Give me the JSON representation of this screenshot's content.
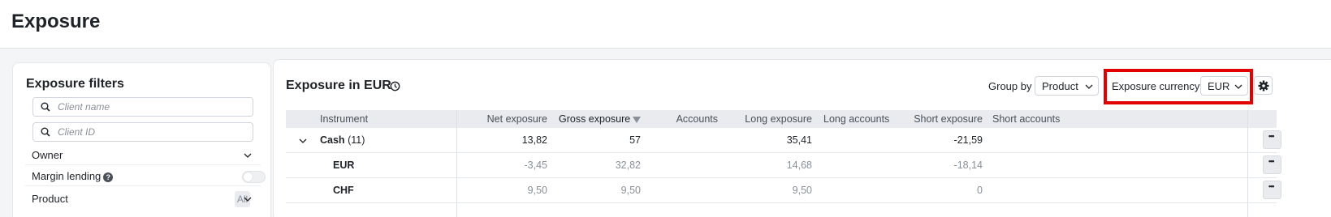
{
  "page": {
    "title": "Exposure"
  },
  "filters": {
    "title": "Exposure filters",
    "client_name_placeholder": "Client name",
    "client_id_placeholder": "Client ID",
    "owner_label": "Owner",
    "margin_lending_label": "Margin lending",
    "margin_lending_enabled": false,
    "product_label": "Product",
    "product_value": "All"
  },
  "main": {
    "title": "Exposure in EUR",
    "group_by_label": "Group by",
    "group_by_value": "Product",
    "currency_label": "Exposure currency",
    "currency_value": "EUR"
  },
  "table": {
    "columns": {
      "instrument": "Instrument",
      "net": "Net exposure",
      "gross": "Gross exposure",
      "accounts": "Accounts",
      "long": "Long exposure",
      "long_accounts": "Long accounts",
      "short": "Short exposure",
      "short_accounts": "Short accounts"
    },
    "sorted_column": "gross",
    "sort_direction": "desc",
    "rows": [
      {
        "name": "Cash",
        "count": "(11)",
        "net": "13,82",
        "gross": "57",
        "accounts": "",
        "long": "35,41",
        "long_accounts": "",
        "short": "-21,59",
        "short_accounts": "",
        "expanded": true
      },
      {
        "name": "EUR",
        "net": "-3,45",
        "gross": "32,82",
        "accounts": "",
        "long": "14,68",
        "long_accounts": "",
        "short": "-18,14",
        "short_accounts": ""
      },
      {
        "name": "CHF",
        "net": "9,50",
        "gross": "9,50",
        "accounts": "",
        "long": "9,50",
        "long_accounts": "",
        "short": "0",
        "short_accounts": ""
      }
    ]
  },
  "colors": {
    "highlight": "#e00000",
    "muted_text": "#8a9099",
    "header_bg": "#e9ebee"
  }
}
